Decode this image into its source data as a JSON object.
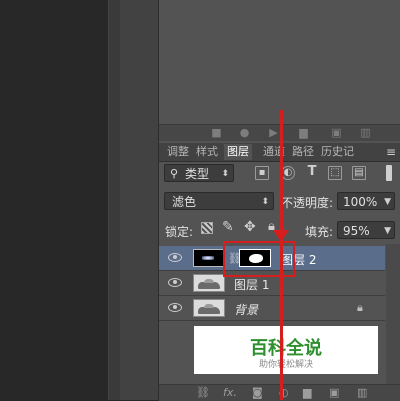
{
  "tabs": [
    "调整",
    "样式",
    "图层",
    "通道",
    "路径",
    "历史记"
  ],
  "active_tab": "图层",
  "filter": {
    "label": "类型"
  },
  "blend": {
    "mode": "滤色",
    "opacity_label": "不透明度:",
    "opacity_value": "100%"
  },
  "lock": {
    "label": "锁定:",
    "fill_label": "填充:",
    "fill_value": "95%"
  },
  "layers": [
    {
      "name": "图层 2",
      "selected": true
    },
    {
      "name": "图层 1",
      "selected": false
    },
    {
      "name": "背景",
      "selected": false
    }
  ],
  "watermark": {
    "title": "百科全说",
    "subtitle": "助你轻松解决"
  },
  "bottom_bar": {
    "fx": "fx."
  },
  "colors": {
    "panel_bg": "#535353",
    "selected_layer": "#5a6e8c",
    "annotation": "#d61e1e",
    "watermark_green": "#2d8f2d"
  }
}
